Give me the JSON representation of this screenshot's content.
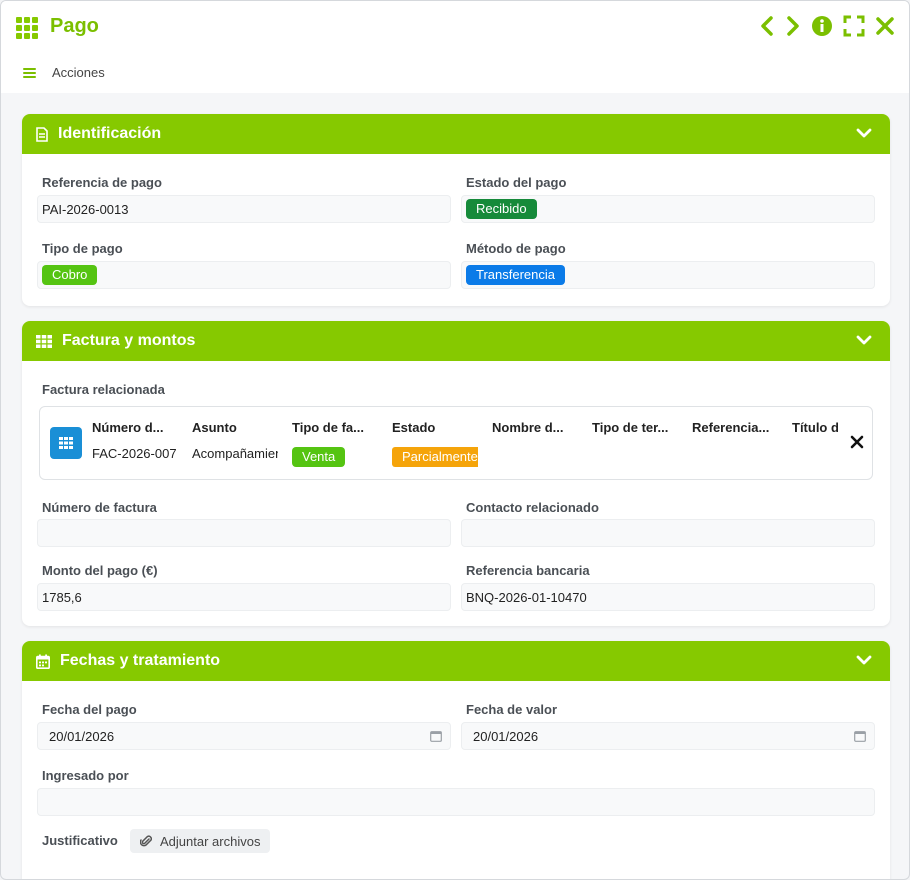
{
  "window": {
    "title": "Pago",
    "actions_label": "Acciones"
  },
  "sections": {
    "identificacion": {
      "title": "Identificación",
      "referencia_label": "Referencia de pago",
      "referencia_value": "PAI-2026-0013",
      "estado_label": "Estado del pago",
      "estado_value": "Recibido",
      "tipo_label": "Tipo de pago",
      "tipo_value": "Cobro",
      "metodo_label": "Método de pago",
      "metodo_value": "Transferencia"
    },
    "factura": {
      "title": "Factura y montos",
      "factura_rel_label": "Factura relacionada",
      "columns": [
        "Número d...",
        "Asunto",
        "Tipo de fa...",
        "Estado",
        "Nombre d...",
        "Tipo de ter...",
        "Referencia...",
        "Título d"
      ],
      "row": {
        "numero": "FAC-2026-007",
        "asunto": "Acompañamiento",
        "tipo": "Venta",
        "estado": "Parcialmente"
      },
      "numero_factura_label": "Número de factura",
      "numero_factura_value": "",
      "contacto_label": "Contacto relacionado",
      "contacto_value": "",
      "monto_label": "Monto del pago (€)",
      "monto_value": "1785,6",
      "ref_bancaria_label": "Referencia bancaria",
      "ref_bancaria_value": "BNQ-2026-01-10470"
    },
    "fechas": {
      "title": "Fechas y tratamiento",
      "fecha_pago_label": "Fecha del pago",
      "fecha_pago_value": "20/01/2026",
      "fecha_valor_label": "Fecha de valor",
      "fecha_valor_value": "20/01/2026",
      "ingresado_label": "Ingresado por",
      "ingresado_value": "",
      "justificativo_label": "Justificativo",
      "adjuntar_label": "Adjuntar archivos"
    }
  },
  "colors": {
    "accent": "#86c900",
    "tag_recibido": "#168a3a",
    "tag_cobro": "#55c412",
    "tag_transferencia": "#0b7be8",
    "tag_parcial": "#f5a40a"
  },
  "icons": {
    "app": "grid-icon",
    "prev": "chevron-left-icon",
    "next": "chevron-right-icon",
    "info": "info-icon",
    "fullscreen": "expand-icon",
    "close": "close-icon"
  }
}
